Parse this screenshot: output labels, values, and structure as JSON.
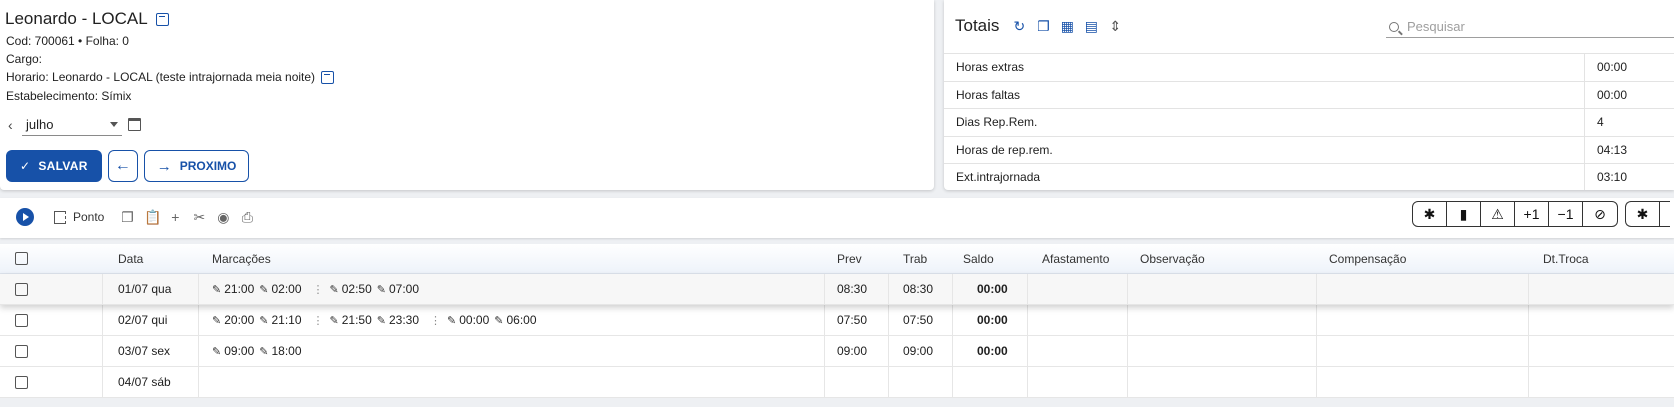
{
  "employee": {
    "name": "Leonardo - LOCAL",
    "cod_line": "Cod: 700061 • Folha: 0",
    "cargo": "Cargo:",
    "horario": "Horario: Leonardo - LOCAL (teste intrajornada meia noite)",
    "estabelecimento": "Estabelecimento: Símix",
    "month": "julho"
  },
  "actions": {
    "save": "SALVAR",
    "next": "PROXIMO"
  },
  "totals": {
    "title": "Totais",
    "search_placeholder": "Pesquisar",
    "rows": [
      {
        "label": "Horas extras",
        "value": "00:00"
      },
      {
        "label": "Horas faltas",
        "value": "00:00"
      },
      {
        "label": "Dias Rep.Rem.",
        "value": "4"
      },
      {
        "label": "Horas de rep.rem.",
        "value": "04:13"
      },
      {
        "label": "Ext.intrajornada",
        "value": "03:10"
      }
    ]
  },
  "toolbar": {
    "ponto_label": "Ponto",
    "right_buttons": [
      "✱",
      "bookmark",
      "warning",
      "+1",
      "−1",
      "block"
    ],
    "right_buttons_extra": [
      "✱"
    ]
  },
  "grid": {
    "headers": {
      "data": "Data",
      "marcacoes": "Marcações",
      "prev": "Prev",
      "trab": "Trab",
      "saldo": "Saldo",
      "afastamento": "Afastamento",
      "observacao": "Observação",
      "compensacao": "Compensação",
      "dt_troca": "Dt.Troca"
    },
    "rows": [
      {
        "data": "01/07 qua",
        "groups": [
          [
            "21:00",
            "02:00"
          ],
          [
            "02:50",
            "07:00"
          ]
        ],
        "prev": "08:30",
        "trab": "08:30",
        "saldo": "00:00"
      },
      {
        "data": "02/07 qui",
        "groups": [
          [
            "20:00",
            "21:10"
          ],
          [
            "21:50",
            "23:30"
          ],
          [
            "00:00",
            "06:00"
          ]
        ],
        "prev": "07:50",
        "trab": "07:50",
        "saldo": "00:00"
      },
      {
        "data": "03/07 sex",
        "groups": [
          [
            "09:00",
            "18:00"
          ]
        ],
        "prev": "09:00",
        "trab": "09:00",
        "saldo": "00:00"
      },
      {
        "data": "04/07 sáb",
        "groups": [],
        "prev": "",
        "trab": "",
        "saldo": ""
      }
    ]
  }
}
